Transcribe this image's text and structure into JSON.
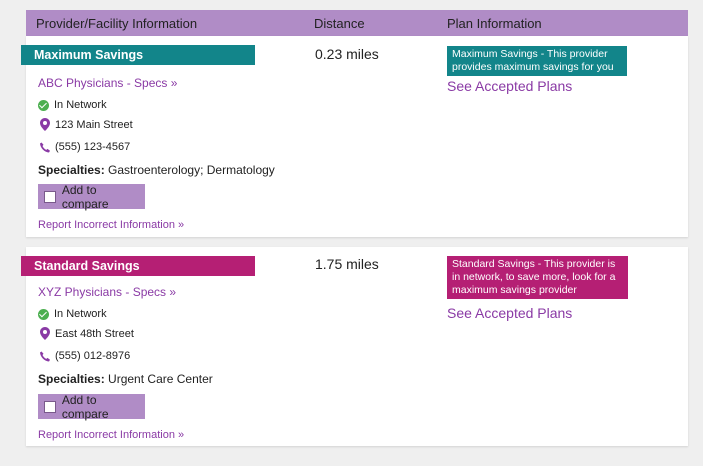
{
  "header": {
    "col_provider": "Provider/Facility Information",
    "col_distance": "Distance",
    "col_plan": "Plan Information"
  },
  "providers": [
    {
      "tier": "Maximum Savings",
      "name": "ABC Physicians - Specs »",
      "network": "In Network",
      "address": "123 Main Street",
      "phone": "(555) 123-4567",
      "specialties_label": "Specialties:",
      "specialties": "Gastroenterology; Dermatology",
      "compare_label": "Add to compare",
      "report_label": "Report Incorrect Information  »",
      "distance": "0.23 miles",
      "plan_info": "Maximum Savings - This provider provides maximum savings for you",
      "accepted_plans": "See Accepted Plans",
      "tier_color": "#12858a"
    },
    {
      "tier": "Standard Savings",
      "name": "XYZ Physicians - Specs »",
      "network": "In Network",
      "address": "East 48th Street",
      "phone": "(555) 012-8976",
      "specialties_label": "Specialties:",
      "specialties": "Urgent Care Center",
      "compare_label": "Add to compare",
      "report_label": "Report Incorrect Information  »",
      "distance": "1.75 miles",
      "plan_info": "Standard Savings - This provider is in network, to save more, look for a maximum savings provider",
      "accepted_plans": "See Accepted Plans",
      "tier_color": "#b51f74"
    }
  ],
  "colors": {
    "header": "#b08cc6",
    "link": "#8a3aa5",
    "check": "#4caf50"
  }
}
